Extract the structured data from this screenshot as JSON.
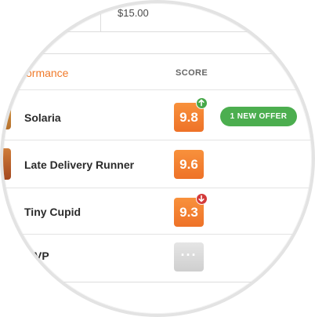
{
  "top_row": {
    "price": "$15.00"
  },
  "header": {
    "performance_label": "ormance",
    "score_label": "SCORE"
  },
  "rows": [
    {
      "name": "Solaria",
      "score": "9.8",
      "trend": "up",
      "offer": "1 NEW OFFER",
      "thumb_color": "#c9893b"
    },
    {
      "name": "Late Delivery Runner",
      "score": "9.6",
      "trend": "none",
      "offer": "",
      "thumb_color": "#c26a2e"
    },
    {
      "name": "Tiny Cupid",
      "score": "9.3",
      "trend": "down",
      "offer": "",
      "thumb_color": "#cfe6e4"
    },
    {
      "name": "VP",
      "score": "···",
      "trend": "none",
      "offer": "",
      "thumb_color": ""
    }
  ],
  "colors": {
    "accent_orange": "#f07a2a",
    "offer_green": "#4cae4f",
    "trend_up": "#47a849",
    "trend_down": "#d33a3a"
  }
}
